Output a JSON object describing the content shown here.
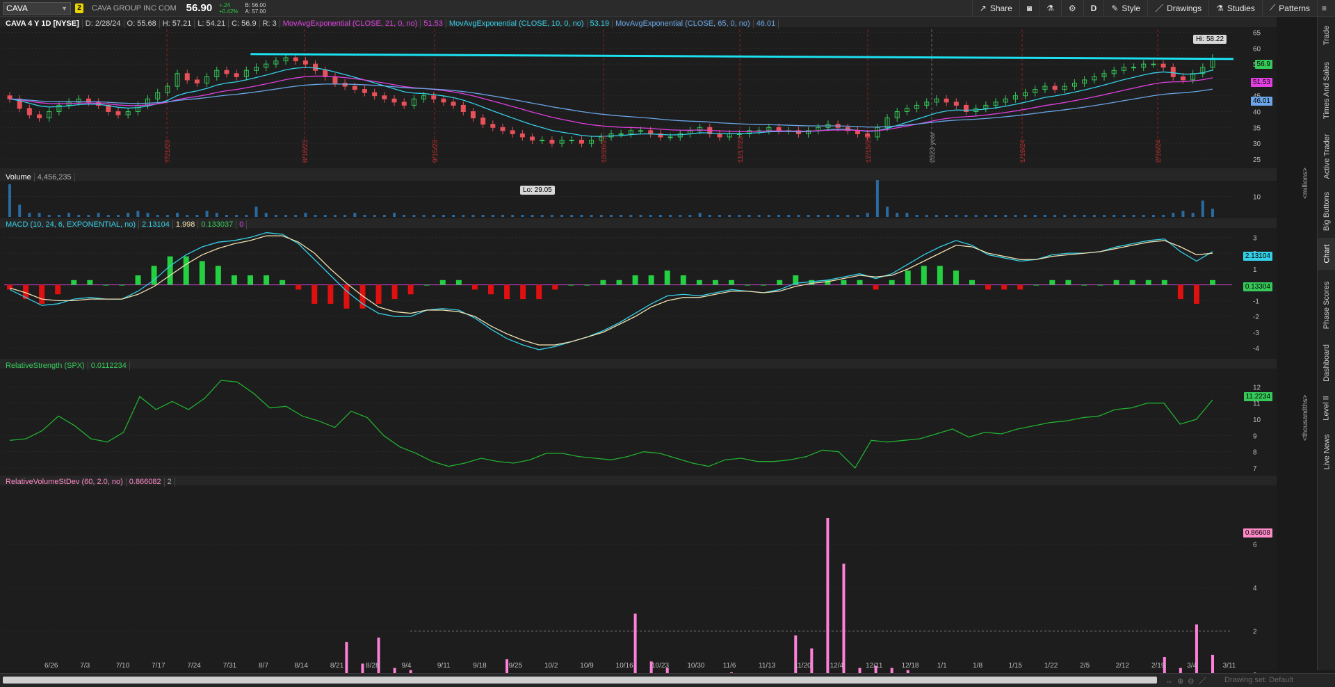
{
  "toolbar": {
    "symbol": "CAVA",
    "link_badge": "2",
    "company": "CAVA GROUP INC COM",
    "last": "56.90",
    "change": "+.24",
    "change_pct": "+0.42%",
    "bid": "B: 56.00",
    "ask": "A: 57.00",
    "buttons": {
      "share": "Share",
      "aggregation": "D",
      "style": "Style",
      "drawings": "Drawings",
      "studies": "Studies",
      "patterns": "Patterns"
    }
  },
  "price_header": {
    "title": "CAVA 4 Y 1D [NYSE]",
    "date": "D: 2/28/24",
    "open": "O: 55.68",
    "high": "H: 57.21",
    "low": "L: 54.21",
    "close": "C: 56.9",
    "r": "R: 3",
    "ema21_label": "MovAvgExponential (CLOSE, 21, 0, no)",
    "ema21_value": "51.53",
    "ema10_label": "MovAvgExponential (CLOSE, 10, 0, no)",
    "ema10_value": "53.19",
    "ema65_label": "MovAvgExponential (CLOSE, 65, 0, no)",
    "ema65_value": "46.01"
  },
  "price_tags": {
    "last": "56.9",
    "ema21": "51.53",
    "ema65": "46.01"
  },
  "annotations": {
    "hi": "Hi: 58.22",
    "lo": "Lo: 29.05"
  },
  "vertical_line_dates": [
    "7/21/23",
    "8/18/23",
    "9/15/23",
    "10/20/23",
    "11/17/23",
    "12/15/23",
    "2023 year",
    "1/19/24",
    "2/16/24"
  ],
  "volume_header": {
    "label": "Volume",
    "value": "4,456,235",
    "unit": "<millions>"
  },
  "macd_header": {
    "label": "MACD (10, 24, 6, EXPONENTIAL, no)",
    "value": "2.13104",
    "avg": "1.998",
    "diff": "0.133037",
    "zero": "0"
  },
  "macd_tags": {
    "value": "2.13104",
    "diff": "0.13304"
  },
  "rs_header": {
    "label": "RelativeStrength (SPX)",
    "value": "0.0112234",
    "unit": "<thousandths>"
  },
  "rs_tag": "11.2234",
  "rv_header": {
    "label": "RelativeVolumeStDev (60, 2.0, no)",
    "value": "0.866082",
    "threshold": "2"
  },
  "rv_tag": "0.86608",
  "side_tabs": [
    "Trade",
    "Times And Sales",
    "Active Trader",
    "Big Buttons",
    "Chart",
    "Phase Scores",
    "Dashboard",
    "Level II",
    "Live News"
  ],
  "bottom": {
    "drawing_set": "Drawing set: Default"
  },
  "colors": {
    "ema10": "#35d0e8",
    "ema21": "#e040e0",
    "ema65": "#6aa6e8",
    "up": "#36c95a",
    "down": "#e8505a",
    "resistance": "#1be0f0"
  },
  "chart_data": [
    {
      "type": "candlestick",
      "panel": "price",
      "ylim": [
        23,
        66
      ],
      "yticks": [
        25,
        30,
        35,
        40,
        45,
        50,
        55,
        60,
        65
      ],
      "x_tick_labels": [
        "6/26",
        "7/3",
        "7/10",
        "7/17",
        "7/24",
        "7/31",
        "8/7",
        "8/14",
        "8/21",
        "8/28",
        "9/4",
        "9/11",
        "9/18",
        "9/25",
        "10/2",
        "10/9",
        "10/16",
        "10/23",
        "10/30",
        "11/6",
        "11/13",
        "11/20",
        "12/4",
        "12/11",
        "12/18",
        "1/1",
        "1/8",
        "1/15",
        "1/22",
        "2/5",
        "2/12",
        "2/19",
        "3/4",
        "3/11"
      ],
      "resistance_level": 57.5,
      "close": [
        44,
        41,
        39,
        38,
        40,
        42,
        43,
        44,
        43,
        42,
        40,
        39,
        40,
        42,
        44,
        46,
        48,
        52,
        50,
        49,
        51,
        53,
        52,
        51,
        53,
        54,
        55,
        56,
        57,
        56,
        55,
        53,
        51,
        49,
        48,
        47,
        46,
        45,
        44,
        43,
        42,
        44,
        45,
        44,
        43,
        42,
        40,
        38,
        36,
        35,
        34,
        33,
        32,
        31,
        31,
        30,
        31,
        31,
        30,
        31,
        32,
        33,
        33,
        34,
        34,
        33,
        32,
        32,
        33,
        34,
        35,
        33,
        32,
        33,
        33,
        34,
        34,
        35,
        34,
        34,
        33,
        34,
        35,
        36,
        35,
        34,
        33,
        32,
        35,
        38,
        40,
        41,
        42,
        43,
        44,
        43,
        42,
        40,
        41,
        42,
        43,
        44,
        45,
        46,
        47,
        48,
        47,
        48,
        49,
        50,
        51,
        52,
        53,
        54,
        54,
        55,
        55,
        54,
        51,
        50,
        52,
        54,
        56.9
      ]
    },
    {
      "type": "bar",
      "panel": "volume",
      "ylabel": "<millions>",
      "ylim": [
        0,
        17
      ],
      "yticks": [
        10
      ],
      "values": [
        16,
        6,
        2,
        2,
        1,
        1,
        2,
        1,
        1,
        2,
        1,
        1,
        2,
        3,
        2,
        1,
        1,
        2,
        1,
        1,
        3,
        2,
        1,
        1,
        1,
        5,
        2,
        1,
        1,
        1,
        2,
        1,
        1,
        1,
        1,
        2,
        1,
        1,
        1,
        2,
        1,
        1,
        1,
        1,
        1,
        1,
        1,
        1,
        1,
        1,
        1,
        1,
        1,
        1,
        1,
        1,
        1,
        1,
        1,
        1,
        1,
        1,
        1,
        1,
        1,
        1,
        1,
        1,
        1,
        1,
        2,
        1,
        1,
        1,
        1,
        1,
        1,
        1,
        1,
        1,
        1,
        1,
        1,
        1,
        1,
        1,
        1,
        2,
        18,
        5,
        2,
        2,
        1,
        1,
        1,
        1,
        1,
        1,
        1,
        1,
        1,
        1,
        1,
        1,
        1,
        1,
        1,
        1,
        1,
        1,
        1,
        1,
        1,
        1,
        1,
        1,
        1,
        1,
        2,
        3,
        2,
        8,
        4
      ]
    },
    {
      "type": "line",
      "panel": "macd",
      "ylim": [
        -4.5,
        3.5
      ],
      "yticks": [
        3,
        2,
        1,
        0,
        -1,
        -2,
        -3,
        -4
      ],
      "series": [
        {
          "name": "MACD",
          "values": [
            -0.3,
            -0.8,
            -1.3,
            -1.2,
            -0.9,
            -0.8,
            -0.9,
            -0.9,
            -0.4,
            0.3,
            1.2,
            1.9,
            2.4,
            2.7,
            2.8,
            3.0,
            3.3,
            3.2,
            2.6,
            1.6,
            0.6,
            -0.4,
            -1.2,
            -1.8,
            -2.0,
            -2.0,
            -1.6,
            -1.5,
            -1.6,
            -2.1,
            -2.8,
            -3.4,
            -3.8,
            -4.1,
            -3.9,
            -3.6,
            -3.3,
            -2.9,
            -2.4,
            -1.8,
            -1.2,
            -0.7,
            -0.6,
            -0.7,
            -0.5,
            -0.3,
            -0.4,
            -0.5,
            -0.3,
            0.1,
            0.2,
            0.3,
            0.5,
            0.7,
            0.4,
            0.7,
            1.3,
            1.9,
            2.4,
            2.8,
            2.5,
            1.9,
            1.7,
            1.5,
            1.6,
            1.9,
            2.0,
            2.0,
            2.1,
            2.4,
            2.6,
            2.8,
            2.9,
            2.1,
            1.5,
            2.1
          ]
        },
        {
          "name": "Avg",
          "values": [
            -0.2,
            -0.5,
            -0.9,
            -1.0,
            -1.0,
            -0.9,
            -0.9,
            -0.9,
            -0.6,
            -0.1,
            0.6,
            1.3,
            1.9,
            2.3,
            2.6,
            2.8,
            3.1,
            3.1,
            2.7,
            2.0,
            1.0,
            0.1,
            -0.7,
            -1.4,
            -1.7,
            -1.8,
            -1.6,
            -1.6,
            -1.7,
            -2.0,
            -2.6,
            -3.1,
            -3.5,
            -3.8,
            -3.8,
            -3.6,
            -3.3,
            -3.0,
            -2.5,
            -2.0,
            -1.4,
            -1.0,
            -0.8,
            -0.8,
            -0.6,
            -0.4,
            -0.4,
            -0.5,
            -0.4,
            -0.1,
            0.1,
            0.2,
            0.4,
            0.6,
            0.5,
            0.6,
            1.0,
            1.5,
            2.0,
            2.5,
            2.4,
            2.0,
            1.8,
            1.6,
            1.6,
            1.8,
            1.9,
            2.0,
            2.1,
            2.3,
            2.5,
            2.7,
            2.8,
            2.4,
            1.9,
            2.0
          ]
        }
      ]
    },
    {
      "type": "line",
      "panel": "relative_strength",
      "ylabel": "<thousandths>",
      "ylim": [
        6.7,
        13
      ],
      "yticks": [
        12,
        11,
        10,
        9,
        8,
        7
      ],
      "series": [
        {
          "name": "RelativeStrength (SPX)",
          "values": [
            8.7,
            8.8,
            9.3,
            10.2,
            9.6,
            8.8,
            8.6,
            9.2,
            11.4,
            10.6,
            11.1,
            10.6,
            11.3,
            12.4,
            12.3,
            11.6,
            10.7,
            10.8,
            10.2,
            9.9,
            9.5,
            10.5,
            10.1,
            9.0,
            8.3,
            7.9,
            7.4,
            7.1,
            7.3,
            7.6,
            7.4,
            7.3,
            7.5,
            7.9,
            7.9,
            7.7,
            7.6,
            7.5,
            7.7,
            8.0,
            7.9,
            7.6,
            7.3,
            7.1,
            7.5,
            7.6,
            7.4,
            7.4,
            7.5,
            7.7,
            8.1,
            8.0,
            7.0,
            8.7,
            8.6,
            8.7,
            8.8,
            9.1,
            9.4,
            8.9,
            9.2,
            9.1,
            9.4,
            9.6,
            9.8,
            9.9,
            10.1,
            10.2,
            10.6,
            10.7,
            11.0,
            11.0,
            9.7,
            10.0,
            11.2
          ]
        }
      ]
    },
    {
      "type": "bar",
      "panel": "relative_volume",
      "ylim": [
        0,
        8
      ],
      "yticks": [
        6,
        4,
        2,
        0
      ],
      "threshold": 2,
      "values": [
        0,
        0,
        0,
        0,
        0,
        0,
        0,
        0,
        0,
        0,
        0,
        0,
        0,
        0,
        0,
        0,
        0,
        0,
        0,
        0,
        0,
        1.5,
        0.5,
        1.7,
        0.3,
        0.2,
        0,
        0,
        0,
        0,
        0,
        0.7,
        0,
        0,
        0,
        0,
        0,
        0,
        0,
        2.8,
        0.6,
        0.3,
        0,
        0,
        0,
        0.1,
        0,
        0,
        0,
        1.8,
        1.2,
        7.2,
        5.1,
        0.3,
        0.4,
        0.3,
        0.2,
        0,
        0,
        0,
        0,
        0,
        0,
        0,
        0,
        0,
        0,
        0,
        0,
        0,
        0,
        0,
        0.8,
        0.3,
        2.3,
        0.9
      ]
    }
  ]
}
